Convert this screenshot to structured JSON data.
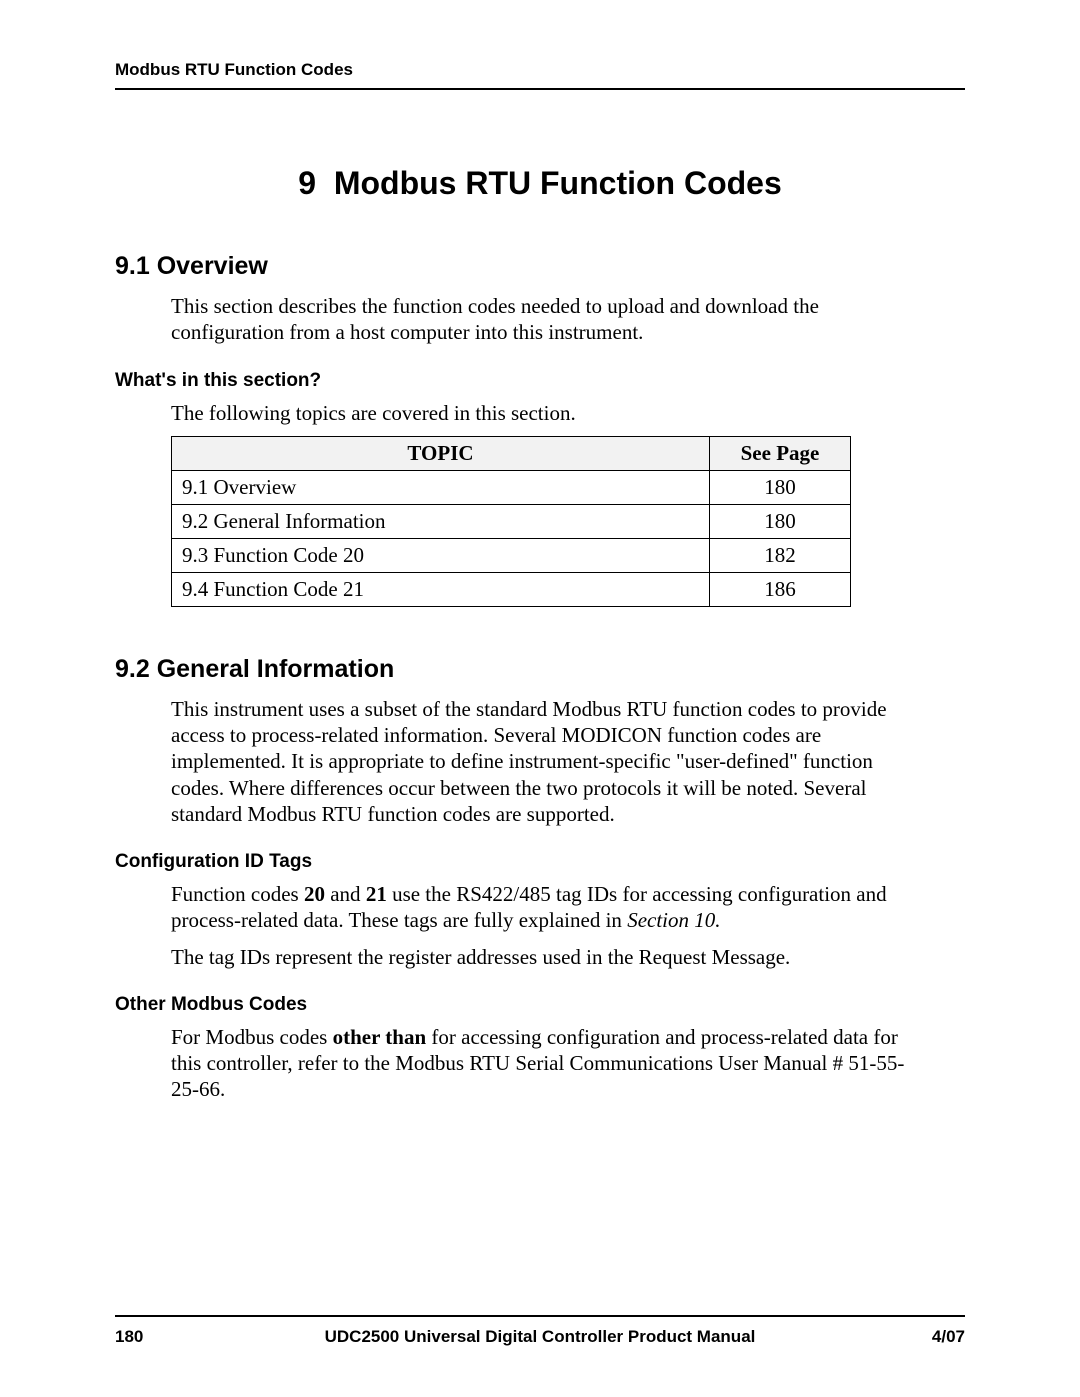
{
  "running_head": "Modbus RTU Function Codes",
  "chapter": {
    "number": "9",
    "title": "Modbus RTU Function Codes"
  },
  "sections": {
    "s91": {
      "heading": "9.1   Overview",
      "intro": "This section describes the function codes needed to upload and download the configuration from a host computer into this instrument.",
      "whats_heading": "What's in this section?",
      "whats_intro": "The following topics are covered in this section.",
      "table": {
        "col_topic": "TOPIC",
        "col_page": "See Page",
        "rows": [
          {
            "topic": "9.1  Overview",
            "page": "180"
          },
          {
            "topic": "9.2  General Information",
            "page": "180"
          },
          {
            "topic": "9.3  Function Code 20",
            "page": "182"
          },
          {
            "topic": "9.4  Function Code 21",
            "page": "186"
          }
        ]
      }
    },
    "s92": {
      "heading": "9.2   General Information",
      "intro": "This instrument uses a subset of the standard Modbus RTU function codes to provide access to process-related information. Several MODICON function codes are implemented. It is appropriate to define instrument-specific \"user-defined\" function codes.  Where differences occur between the two protocols it will be noted. Several standard Modbus RTU function codes are supported.",
      "cfg_heading": "Configuration ID Tags",
      "cfg_p1_a": "Function codes ",
      "cfg_p1_b": "20",
      "cfg_p1_c": " and ",
      "cfg_p1_d": "21",
      "cfg_p1_e": " use the RS422/485 tag IDs for accessing configuration and process-related data. These tags are fully explained in ",
      "cfg_p1_f": "Section 10.",
      "cfg_p2": "The tag IDs represent the register addresses used in the Request Message.",
      "other_heading": "Other Modbus Codes",
      "other_p1_a": "For Modbus codes ",
      "other_p1_b": "other than",
      "other_p1_c": " for accessing configuration and process-related data for this controller, refer to the Modbus RTU Serial Communications User Manual # 51-55-25-66."
    }
  },
  "footer": {
    "page": "180",
    "title": "UDC2500 Universal Digital Controller Product Manual",
    "date": "4/07"
  }
}
